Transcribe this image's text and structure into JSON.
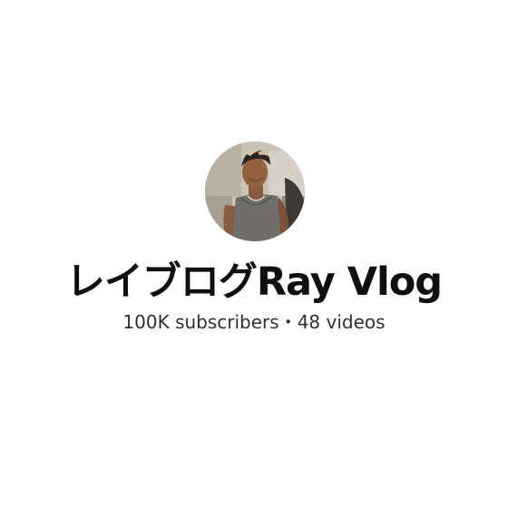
{
  "channel": {
    "name": "レイブログRay Vlog",
    "subscribers": "100K subscribers",
    "separator": "・",
    "videos": "48 videos"
  }
}
